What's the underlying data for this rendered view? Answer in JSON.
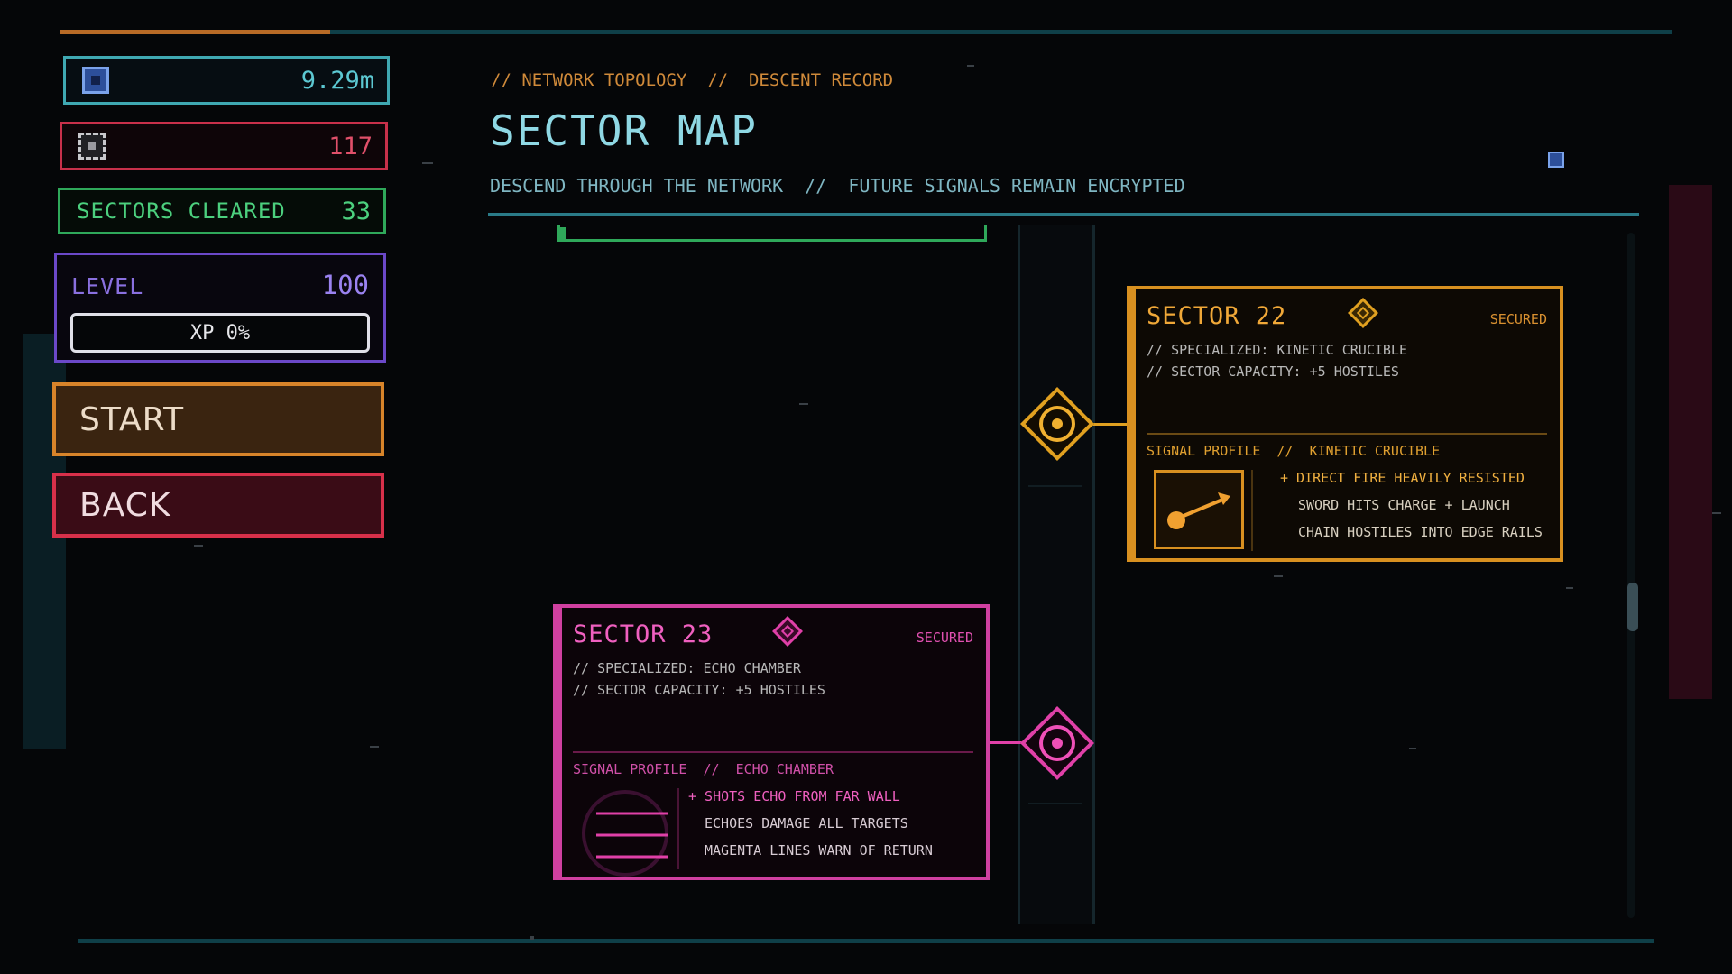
{
  "hud": {
    "distance": {
      "icon": "depth-icon",
      "value": "9.29m"
    },
    "kills": {
      "icon": "skull-icon",
      "value": "117"
    },
    "sectors_cleared": {
      "label": "SECTORS CLEARED",
      "value": "33"
    },
    "level": {
      "label": "LEVEL",
      "value": "100",
      "xp_label": "XP 0%",
      "xp_fraction": 0
    }
  },
  "buttons": {
    "start": "START",
    "back": "BACK"
  },
  "header": {
    "breadcrumb": "// NETWORK TOPOLOGY  //  DESCENT RECORD",
    "title": "SECTOR MAP",
    "subtitle": "DESCEND THROUGH THE NETWORK  //  FUTURE SIGNALS REMAIN ENCRYPTED"
  },
  "sectors": [
    {
      "title": "SECTOR 22",
      "status": "SECURED",
      "specialized": "// SPECIALIZED: KINETIC CRUCIBLE",
      "capacity": "// SECTOR CAPACITY: +5 HOSTILES",
      "profile": "SIGNAL PROFILE  //  KINETIC CRUCIBLE",
      "lines": [
        "+ DIRECT FIRE HEAVILY RESISTED",
        "SWORD HITS CHARGE + LAUNCH",
        "CHAIN HOSTILES INTO EDGE RAILS"
      ],
      "icon": "kinetic-launch-icon",
      "accent": "#e0a020"
    },
    {
      "title": "SECTOR 23",
      "status": "SECURED",
      "specialized": "// SPECIALIZED: ECHO CHAMBER",
      "capacity": "// SECTOR CAPACITY: +5 HOSTILES",
      "profile": "SIGNAL PROFILE  //  ECHO CHAMBER",
      "lines": [
        "+ SHOTS ECHO FROM FAR WALL",
        "ECHOES DAMAGE ALL TARGETS",
        "MAGENTA LINES WARN OF RETURN"
      ],
      "icon": "echo-wave-icon",
      "accent": "#e040a8"
    }
  ]
}
